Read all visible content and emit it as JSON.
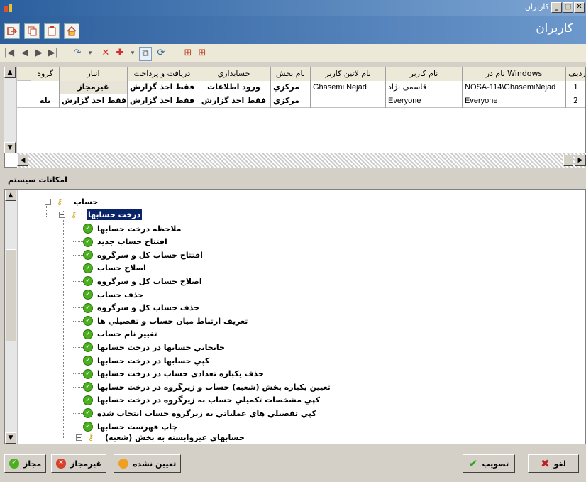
{
  "window": {
    "title": "کاربران",
    "header_title": "کاربران"
  },
  "grid": {
    "columns": [
      "ردیف",
      "نام در Windows",
      "نام کاربر",
      "نام لاتین کاربر",
      "نام بخش",
      "حسابداري",
      "دريافت و پرداخت",
      "انبار",
      "گروه"
    ],
    "rows": [
      [
        "1",
        "NOSA-114\\GhasemiNejad",
        "قاسمی نژاد",
        "Ghasemi Nejad",
        "مرکزي",
        "ورود اطلاعات",
        "فقط اخذ گزارش",
        "غيرمجاز",
        ""
      ],
      [
        "2",
        "Everyone",
        "Everyone",
        "",
        "مرکزي",
        "فقط اخذ گزارش",
        "فقط اخذ گزارش",
        "فقط اخذ گزارش",
        "بله"
      ]
    ]
  },
  "section_label": "امکانات سيستم",
  "tree": {
    "root": "حساب",
    "parent": "درخت حسابها",
    "children": [
      "ملاحظه درخت حسابها",
      "افتتاح حساب جديد",
      "افتتاح حساب کل و سرگروه",
      "اصلاح حساب",
      "اصلاح حساب کل و سرگروه",
      "حذف حساب",
      "حذف حساب کل و سرگروه",
      "تعريف ارتباط ميان حساب و تفصيلي ها",
      "تغيير نام حساب",
      "جابجايي حسابها در درخت حسابها",
      "کپي حسابها در درخت حسابها",
      "حذف يکباره تعدادي حساب در درخت حسابها",
      "تعيين يکباره بخش (شعبه) حساب و زيرگروه در درخت حسابها",
      "کپي مشخصات تکميلي حساب به زيرگروه در درخت حسابها",
      "کپي تفصيلي هاي عملياتي به زيرگروه حساب انتخاب شده",
      "چاپ فهرست حسابها"
    ],
    "last": "حسابهاي غيروابسته به بخش (شعبه)"
  },
  "buttons": {
    "allowed": "مجاز",
    "denied": "غيرمجاز",
    "unset": "تعيين نشده",
    "approve": "تصويب",
    "cancel": "لغو"
  },
  "colors": {
    "accent": "#2c5e9c",
    "selected": "#0a246a",
    "check": "#4caf20",
    "deny": "#d9402a",
    "unset": "#f0a020"
  }
}
